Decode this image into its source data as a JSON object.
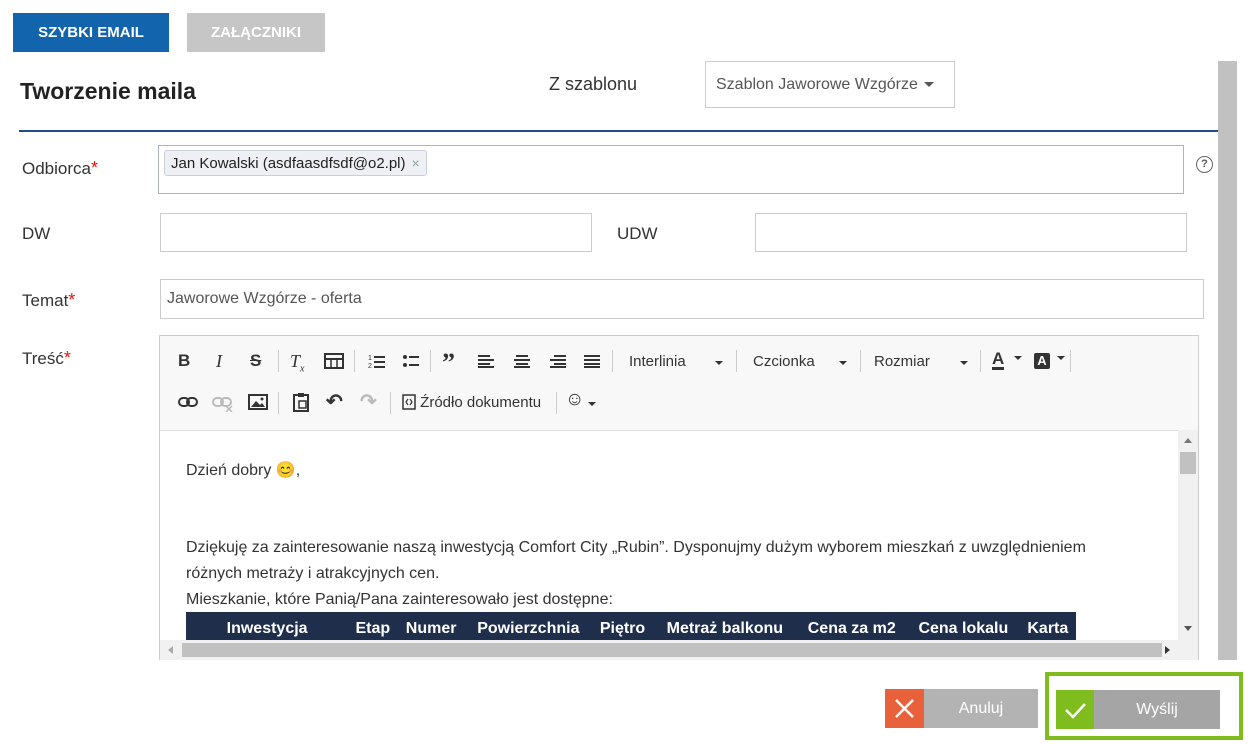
{
  "tabs": [
    {
      "label": "SZYBKI EMAIL",
      "active": true
    },
    {
      "label": "ZAŁĄCZNIKI",
      "active": false
    }
  ],
  "title": "Tworzenie maila",
  "template": {
    "label": "Z szablonu",
    "selected": "Szablon Jaworowe Wzgórze"
  },
  "fields": {
    "recipient": {
      "label": "Odbiorca",
      "required_mark": "*",
      "chip": "Jan Kowalski (asdfaasdfsdf@o2.pl)",
      "chip_remove": "×",
      "help": "?"
    },
    "cc": {
      "label": "DW",
      "value": ""
    },
    "bcc": {
      "label": "UDW",
      "value": ""
    },
    "subject": {
      "label": "Temat",
      "required_mark": "*",
      "value": "Jaworowe Wzgórze - oferta"
    },
    "body": {
      "label": "Treść",
      "required_mark": "*"
    }
  },
  "toolbar": {
    "line_height": "Interlinia",
    "font": "Czcionka",
    "size": "Rozmiar",
    "source": "Źródło dokumentu"
  },
  "content": {
    "greeting": "Dzień dobry",
    "greeting_emoji": "😊",
    "greeting_tail": ",",
    "para1": "Dziękuję za zainteresowanie naszą inwestycją Comfort City „Rubin”. Dysponujmy dużym wyborem mieszkań z uwzględnieniem",
    "para2": "różnych metraży i atrakcyjnych cen.",
    "para3": "Mieszkanie, które Panią/Pana zainteresowało jest dostępne:",
    "table_headers": [
      "Inwestycja",
      "Etap",
      "Numer",
      "Powierzchnia",
      "Piętro",
      "Metraż balkonu",
      "Cena za m2",
      "Cena lokalu",
      "Karta"
    ]
  },
  "buttons": {
    "cancel": "Anuluj",
    "send": "Wyślij"
  },
  "colors": {
    "primary": "#1265ad",
    "accent_green": "#7ebd1d",
    "cancel_red": "#e8613b",
    "table_header": "#1f2f4b",
    "required": "#ee1111"
  }
}
